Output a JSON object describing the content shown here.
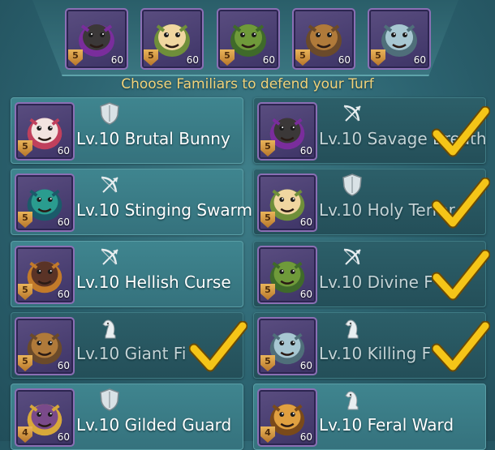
{
  "header": {
    "instruction": "Choose Familiars to defend your Turf"
  },
  "selected_slots": [
    {
      "icon": "savage-breath-portrait-icon",
      "star": "5",
      "level": "60",
      "colors": [
        "#3b3838",
        "#7a2d9c"
      ]
    },
    {
      "icon": "holy-terror-portrait-icon",
      "star": "5",
      "level": "60",
      "colors": [
        "#f0d6a0",
        "#6f8f3a"
      ]
    },
    {
      "icon": "divine-portrait-icon",
      "star": "5",
      "level": "60",
      "colors": [
        "#6f9a3a",
        "#3f6a2a"
      ]
    },
    {
      "icon": "giant-portrait-icon",
      "star": "5",
      "level": "60",
      "colors": [
        "#b07a3a",
        "#6b4a2a"
      ]
    },
    {
      "icon": "killing-portrait-icon",
      "star": "5",
      "level": "60",
      "colors": [
        "#a7c7d2",
        "#4f6f7a"
      ]
    }
  ],
  "familiars": [
    {
      "name": "Lv.10 Brutal Bunny",
      "star": "5",
      "level": "60",
      "role": "defense-shield-icon",
      "selected": false,
      "colors": [
        "#f3e4e0",
        "#c0405c"
      ]
    },
    {
      "name": "Lv.10 Savage Breath",
      "star": "5",
      "level": "60",
      "role": "attack-bow-icon",
      "selected": true,
      "colors": [
        "#3b3838",
        "#7a2d9c"
      ]
    },
    {
      "name": "Lv.10 Stinging Swarm",
      "star": "5",
      "level": "60",
      "role": "attack-bow-icon",
      "selected": false,
      "colors": [
        "#2a9c8f",
        "#1b5b6a"
      ]
    },
    {
      "name": "Lv.10 Holy Terror",
      "star": "5",
      "level": "60",
      "role": "defense-shield-icon",
      "selected": true,
      "colors": [
        "#f0d6a0",
        "#6f8f3a"
      ]
    },
    {
      "name": "Lv.10 Hellish Curse",
      "star": "5",
      "level": "60",
      "role": "attack-bow-icon",
      "selected": false,
      "colors": [
        "#5a3326",
        "#c27a2a"
      ]
    },
    {
      "name": "Lv.10 Divine F",
      "star": "5",
      "level": "60",
      "role": "attack-bow-icon",
      "selected": true,
      "colors": [
        "#6f9a3a",
        "#3f6a2a"
      ]
    },
    {
      "name": "Lv.10 Giant Fi",
      "star": "5",
      "level": "60",
      "role": "support-knight-icon",
      "selected": true,
      "colors": [
        "#b07a3a",
        "#6b4a2a"
      ]
    },
    {
      "name": "Lv.10 Killing F",
      "star": "5",
      "level": "60",
      "role": "support-knight-icon",
      "selected": true,
      "colors": [
        "#a7c7d2",
        "#4f6f7a"
      ]
    },
    {
      "name": "Lv.10 Gilded Guard",
      "star": "4",
      "level": "60",
      "role": "defense-shield-icon",
      "selected": false,
      "colors": [
        "#7a4a8a",
        "#d8a83a"
      ]
    },
    {
      "name": "Lv.10 Feral Ward",
      "star": "4",
      "level": "60",
      "role": "support-knight-icon",
      "selected": false,
      "colors": [
        "#e0a040",
        "#7a4a1a"
      ]
    }
  ],
  "colors": {
    "title_text": "#f2d37a",
    "check_mark": "#f5c518",
    "frame_purple": "#8a6fb4",
    "card_teal": "#3f858f"
  }
}
